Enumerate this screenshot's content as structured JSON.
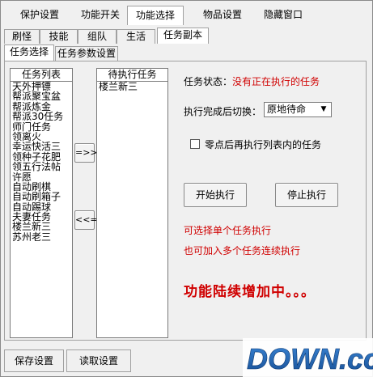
{
  "top_tabs": [
    "保护设置",
    "功能开关",
    "功能选择",
    "物品设置",
    "隐藏窗口"
  ],
  "sub_tabs": [
    "刷怪",
    "技能",
    "组队",
    "生活",
    "任务副本"
  ],
  "inner_tabs": [
    "任务选择",
    "任务参数设置"
  ],
  "task_list": {
    "header": "任务列表",
    "items": [
      "天外押镖",
      "帮派聚宝盆",
      "帮派炼金",
      "帮派30任务",
      "师门任务",
      "领离火",
      "幸运快活三",
      "领种子花肥",
      "领五行法帖",
      "许愿",
      "自动刷棋",
      "自动刷箱子",
      "自动踢球",
      "夫妻任务",
      "楼兰新三",
      "苏州老三"
    ]
  },
  "pending_list": {
    "header": "待执行任务",
    "items": [
      "楼兰新三"
    ]
  },
  "move_right_label": "=>>",
  "move_left_label": "<<=",
  "status": {
    "label": "任务状态：",
    "value": "没有正在执行的任务"
  },
  "switch_after": {
    "label": "执行完成后切换：",
    "selected": "原地待命"
  },
  "midnight_option": {
    "label": "零点后再执行列表内的任务",
    "checked": false
  },
  "start_button": "开始执行",
  "stop_button": "停止执行",
  "hint_single": "可选择单个任务执行",
  "hint_multi": "也可加入多个任务连续执行",
  "more_coming": "功能陆续增加中。。。",
  "save_button": "保存设置",
  "load_button": "读取设置",
  "watermark": "DOWN.cc",
  "colors": {
    "accent_red": "#d00000",
    "logo_blue": "#1f5fa8"
  }
}
